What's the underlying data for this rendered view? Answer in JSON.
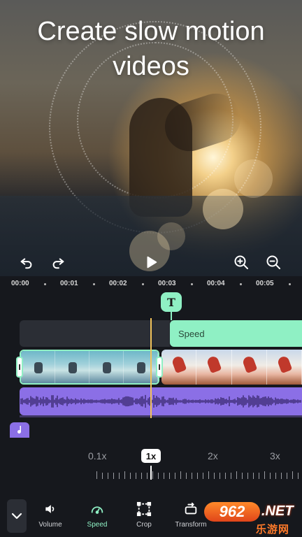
{
  "preview": {
    "headline_line1": "Create slow motion",
    "headline_line2": "videos",
    "undo_icon": "undo-icon",
    "redo_icon": "redo-icon",
    "play_icon": "play-icon",
    "zoom_in_icon": "zoom-in-icon",
    "zoom_out_icon": "zoom-out-icon"
  },
  "timeline": {
    "ticks": [
      "00:00",
      "00:01",
      "00:02",
      "00:03",
      "00:04",
      "00:05"
    ],
    "text_marker": "T",
    "speed_track_label": "Speed",
    "music_icon": "music-note-icon",
    "colors": {
      "accent_green": "#8ff0c4",
      "audio_purple": "#8b6fe6",
      "playhead": "#f2c35b"
    }
  },
  "speed_control": {
    "options": [
      "0.1x",
      "1x",
      "2x",
      "3x"
    ],
    "selected": "1x"
  },
  "toolbar": {
    "collapse_icon": "chevron-down-icon",
    "items": [
      {
        "label": "Volume",
        "icon": "volume-icon",
        "active": false
      },
      {
        "label": "Speed",
        "icon": "speedometer-icon",
        "active": true
      },
      {
        "label": "Crop",
        "icon": "crop-icon",
        "active": false
      },
      {
        "label": "Transform",
        "icon": "transform-icon",
        "active": false
      }
    ]
  },
  "watermark": {
    "number": "962",
    "domain": ".NET",
    "chinese": "乐游网"
  }
}
